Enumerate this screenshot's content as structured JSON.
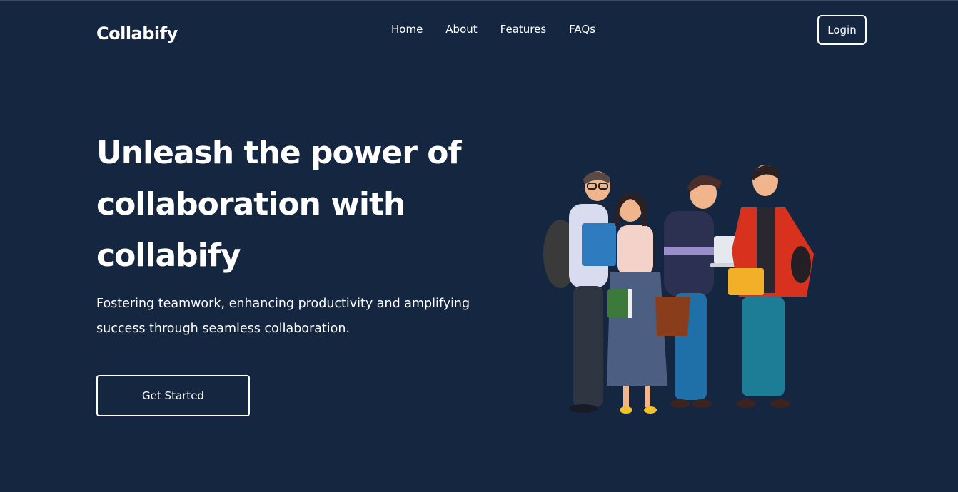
{
  "header": {
    "brand": "Collabify",
    "nav": [
      "Home",
      "About",
      "Features",
      "FAQs"
    ],
    "login_label": "Login"
  },
  "hero": {
    "title": "Unleash the power of collaboration with collabify",
    "subtitle": "Fostering teamwork, enhancing productivity and amplifying success through seamless collaboration.",
    "cta_label": "Get Started"
  },
  "colors": {
    "background": "#152641",
    "text": "#ffffff",
    "outline": "#ffffff"
  }
}
